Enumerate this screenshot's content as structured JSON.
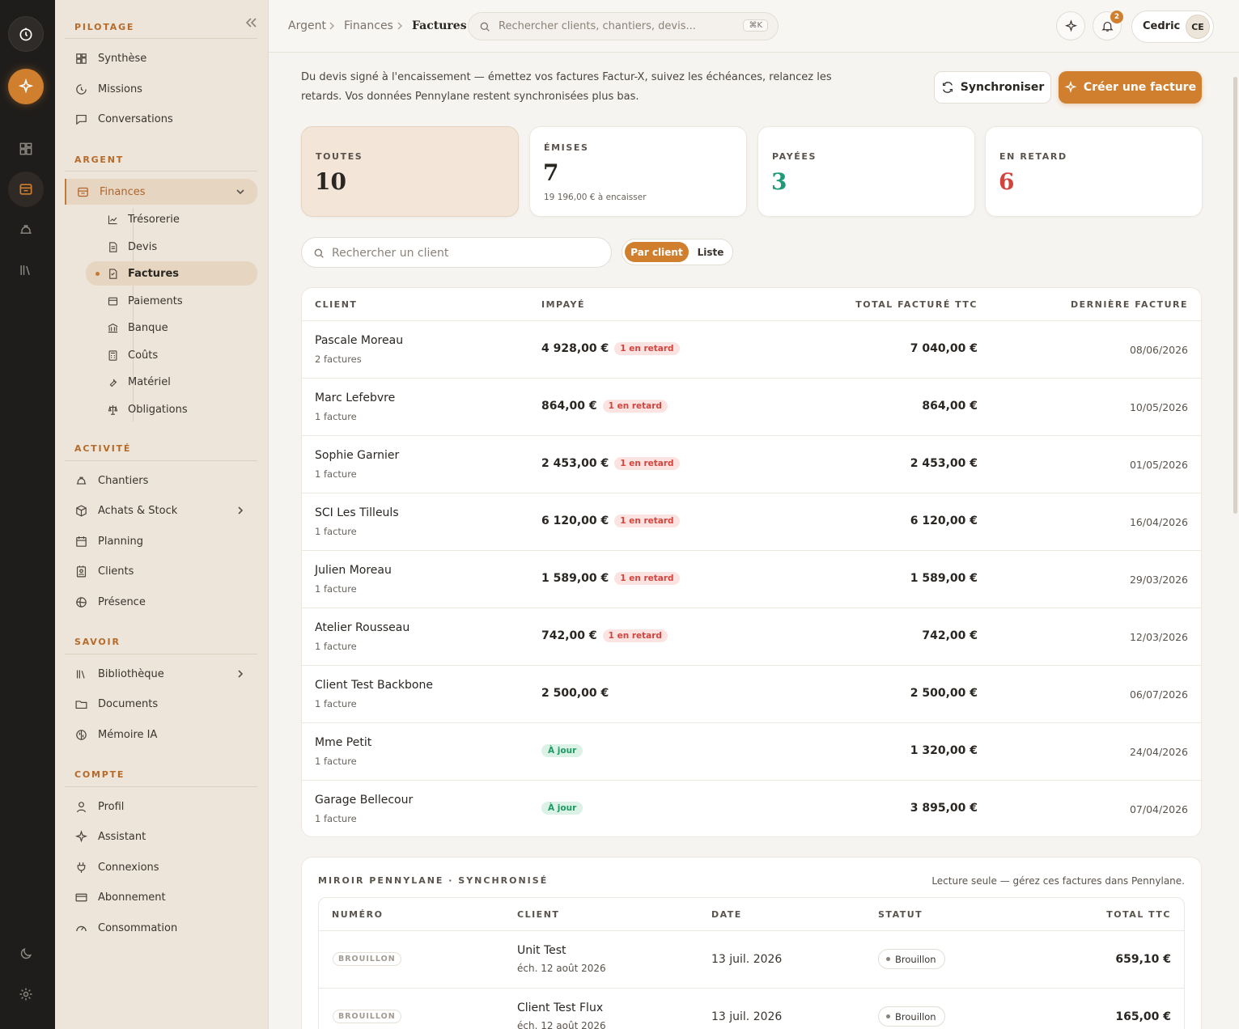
{
  "sidebar": {
    "sections": {
      "pilotage": "PILOTAGE",
      "argent": "ARGENT",
      "activite": "ACTIVITÉ",
      "savoir": "SAVOIR",
      "compte": "COMPTE"
    },
    "items": {
      "synthese": "Synthèse",
      "missions": "Missions",
      "conversations": "Conversations",
      "finances": "Finances",
      "tresorerie": "Trésorerie",
      "devis": "Devis",
      "factures": "Factures",
      "paiements": "Paiements",
      "banque": "Banque",
      "couts": "Coûts",
      "materiel": "Matériel",
      "obligations": "Obligations",
      "chantiers": "Chantiers",
      "achats": "Achats & Stock",
      "planning": "Planning",
      "clients": "Clients",
      "presence": "Présence",
      "bibliotheque": "Bibliothèque",
      "documents": "Documents",
      "memoire": "Mémoire IA",
      "profil": "Profil",
      "assistant": "Assistant",
      "connexions": "Connexions",
      "abonnement": "Abonnement",
      "consommation": "Consommation"
    }
  },
  "topbar": {
    "breadcrumb": [
      "Argent",
      "Finances",
      "Factures"
    ],
    "search_placeholder": "Rechercher clients, chantiers, devis...",
    "shortcut": "⌘K",
    "notifications": "2",
    "user_name": "Cedric",
    "user_initials": "CE"
  },
  "intro": "Du devis signé à l'encaissement — émettez vos factures Factur-X, suivez les échéances, relancez les retards. Vos données Pennylane restent synchronisées plus bas.",
  "actions": {
    "sync": "Synchroniser",
    "create": "Créer une facture"
  },
  "stats": [
    {
      "label": "TOUTES",
      "value": "10",
      "sub": "",
      "color": "#2a2622"
    },
    {
      "label": "ÉMISES",
      "value": "7",
      "sub": "19 196,00 € à encaisser",
      "color": "#2a2622"
    },
    {
      "label": "PAYÉES",
      "value": "3",
      "sub": "",
      "color": "#1f9a78"
    },
    {
      "label": "EN RETARD",
      "value": "6",
      "sub": "",
      "color": "#d2453e"
    }
  ],
  "filter": {
    "placeholder": "Rechercher un client",
    "by_client": "Par client",
    "list": "Liste"
  },
  "table": {
    "headers": {
      "client": "CLIENT",
      "unpaid": "IMPAYÉ",
      "total": "TOTAL FACTURÉ TTC",
      "last": "DERNIÈRE FACTURE"
    },
    "rows": [
      {
        "name": "Pascale Moreau",
        "count": "2 factures",
        "unpaid": "4 928,00 €",
        "badge": "1 en retard",
        "badge_type": "late",
        "total": "7 040,00 €",
        "last": "08/06/2026"
      },
      {
        "name": "Marc Lefebvre",
        "count": "1 facture",
        "unpaid": "864,00 €",
        "badge": "1 en retard",
        "badge_type": "late",
        "total": "864,00 €",
        "last": "10/05/2026"
      },
      {
        "name": "Sophie Garnier",
        "count": "1 facture",
        "unpaid": "2 453,00 €",
        "badge": "1 en retard",
        "badge_type": "late",
        "total": "2 453,00 €",
        "last": "01/05/2026"
      },
      {
        "name": "SCI Les Tilleuls",
        "count": "1 facture",
        "unpaid": "6 120,00 €",
        "badge": "1 en retard",
        "badge_type": "late",
        "total": "6 120,00 €",
        "last": "16/04/2026"
      },
      {
        "name": "Julien Moreau",
        "count": "1 facture",
        "unpaid": "1 589,00 €",
        "badge": "1 en retard",
        "badge_type": "late",
        "total": "1 589,00 €",
        "last": "29/03/2026"
      },
      {
        "name": "Atelier Rousseau",
        "count": "1 facture",
        "unpaid": "742,00 €",
        "badge": "1 en retard",
        "badge_type": "late",
        "total": "742,00 €",
        "last": "12/03/2026"
      },
      {
        "name": "Client Test Backbone",
        "count": "1 facture",
        "unpaid": "2 500,00 €",
        "badge": "",
        "badge_type": "none",
        "total": "2 500,00 €",
        "last": "06/07/2026"
      },
      {
        "name": "Mme Petit",
        "count": "1 facture",
        "unpaid": "",
        "badge": "À jour",
        "badge_type": "ok",
        "total": "1 320,00 €",
        "last": "24/04/2026"
      },
      {
        "name": "Garage Bellecour",
        "count": "1 facture",
        "unpaid": "",
        "badge": "À jour",
        "badge_type": "ok",
        "total": "3 895,00 €",
        "last": "07/04/2026"
      }
    ]
  },
  "mirror": {
    "title": "MIROIR PENNYLANE · SYNCHRONISÉ",
    "note": "Lecture seule — gérez ces factures dans Pennylane.",
    "headers": {
      "number": "NUMÉRO",
      "client": "CLIENT",
      "date": "DATE",
      "status": "STATUT",
      "total": "TOTAL TTC"
    },
    "rows": [
      {
        "number": "BROUILLON",
        "client": "Unit Test",
        "due": "éch. 12 août 2026",
        "date": "13 juil. 2026",
        "status": "Brouillon",
        "total": "659,10 €"
      },
      {
        "number": "BROUILLON",
        "client": "Client Test Flux",
        "due": "éch. 12 août 2026",
        "date": "13 juil. 2026",
        "status": "Brouillon",
        "total": "165,00 €"
      }
    ]
  }
}
